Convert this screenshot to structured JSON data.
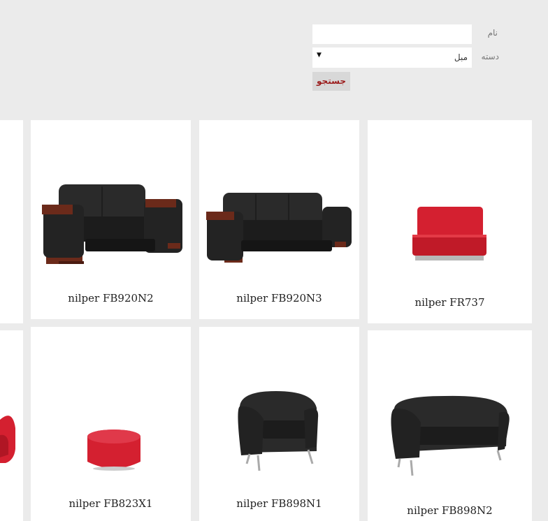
{
  "search_form": {
    "name_label": "نام",
    "name_value": "",
    "category_label": "دسته",
    "category_value": "مبل",
    "category_arrow": "▼",
    "submit_label": "جستجو"
  },
  "products": [
    {
      "name": "nilper FB920N2",
      "image": "black-leather-loveseat",
      "color": "#1f1f1f"
    },
    {
      "name": "nilper FB920N3",
      "image": "black-leather-three-seat-sofa",
      "color": "#1f1f1f"
    },
    {
      "name": "nilper FR737",
      "image": "red-booth-seat",
      "color": "#d42030"
    },
    {
      "name": "nilper FB823X1",
      "image": "red-round-pouf",
      "color": "#d42030"
    },
    {
      "name": "nilper FB898N1",
      "image": "black-tub-armchair",
      "color": "#1f1f1f"
    },
    {
      "name": "nilper FB898N2",
      "image": "black-tub-loveseat",
      "color": "#1f1f1f"
    }
  ],
  "colors": {
    "background": "#ebebeb",
    "button_text": "#9b1b1b",
    "card": "#ffffff"
  }
}
